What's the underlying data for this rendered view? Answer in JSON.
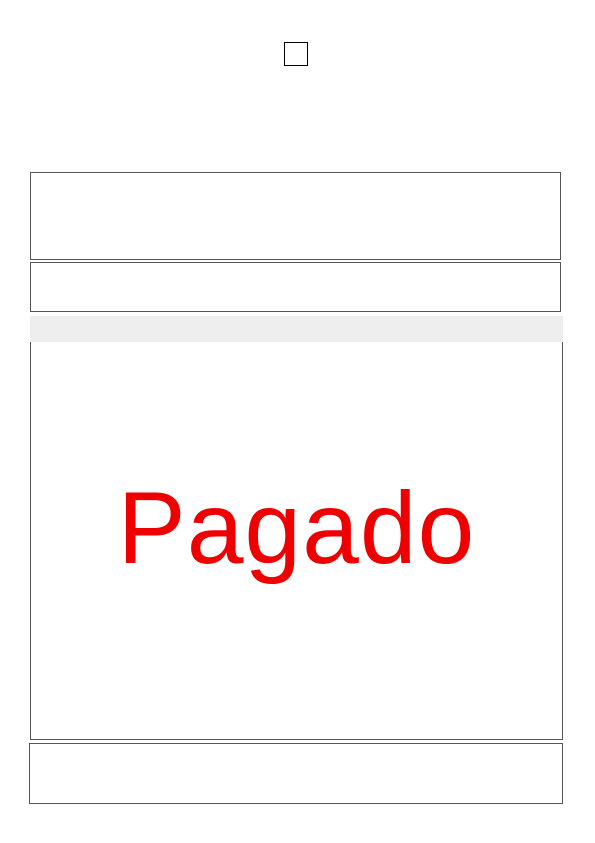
{
  "document": {
    "status_stamp": "Pagado",
    "stamp_color": "#ee0000"
  }
}
